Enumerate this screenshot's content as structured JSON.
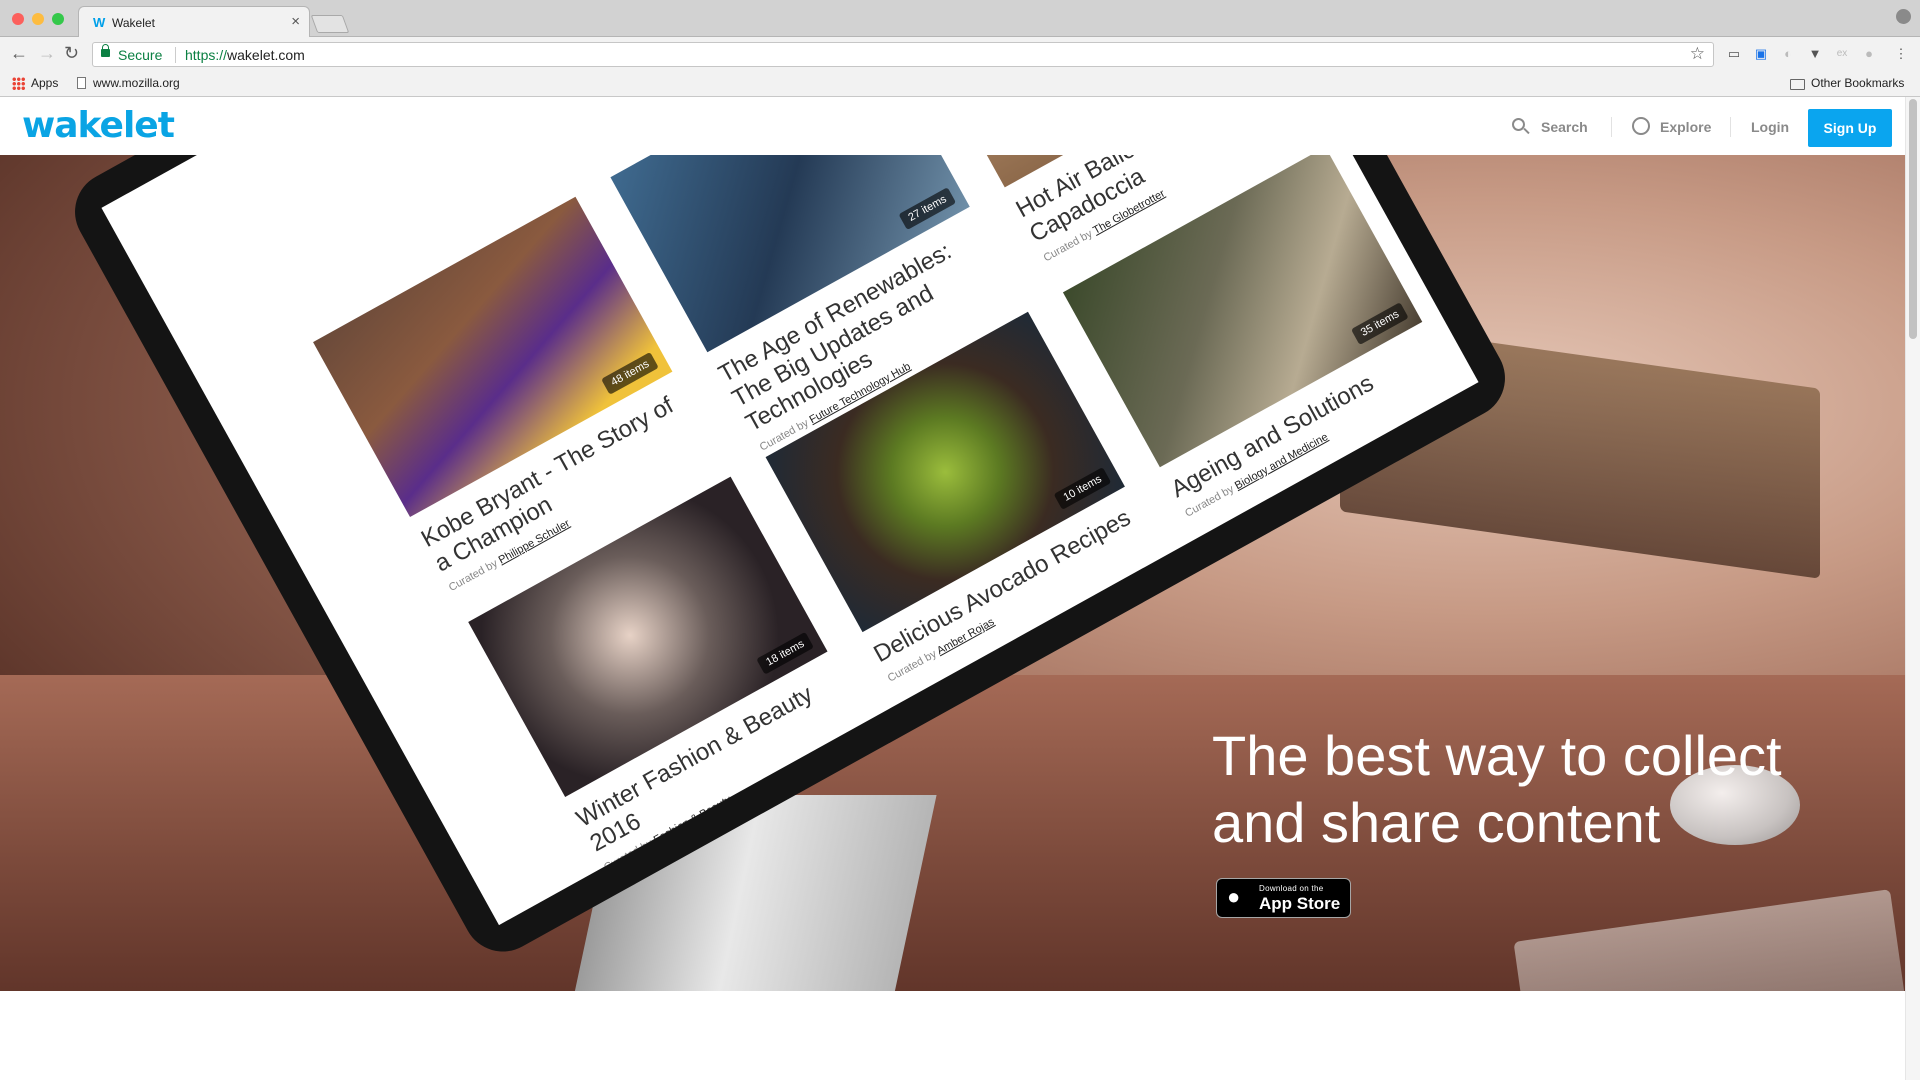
{
  "browser": {
    "tab_title": "Wakelet",
    "tab_favicon": "W",
    "secure_label": "Secure",
    "url_scheme": "https://",
    "url_host": "wakelet.com",
    "bookmarks": [
      {
        "label": "Apps"
      },
      {
        "label": "www.mozilla.org"
      }
    ],
    "other_bookmarks": "Other Bookmarks"
  },
  "header": {
    "logo": "wakelet",
    "nav": {
      "search": "Search",
      "explore": "Explore",
      "login": "Login",
      "signup": "Sign Up"
    }
  },
  "hero": {
    "tagline": "The best way to collect and share content",
    "appstore": {
      "small": "Download on the",
      "big": "App Store"
    }
  },
  "screen_cards": [
    {
      "title": "Kobe Bryant - The Story of a Champion",
      "curated_prefix": "Curated by",
      "curator": "Philippe Schuler",
      "count": "48 items"
    },
    {
      "title": "The Age of Renewables: The Big Updates and Technologies",
      "curated_prefix": "Curated by",
      "curator": "Future Technology Hub",
      "count": "27 items"
    },
    {
      "title": "Hot Air Balloon over Capadoccia",
      "curated_prefix": "Curated by",
      "curator": "The Globetrotter",
      "count": ""
    },
    {
      "title": "Winter Fashion & Beauty 2016",
      "curated_prefix": "Curated by",
      "curator": "Fashion & Beauty",
      "count": "18 items"
    },
    {
      "title": "Delicious Avocado Recipes",
      "curated_prefix": "Curated by",
      "curator": "Amber Rojas",
      "count": "10 items"
    },
    {
      "title": "Ageing and Solutions",
      "curated_prefix": "Curated by",
      "curator": "Biology and Medicine",
      "count": "35 items"
    }
  ],
  "colors": {
    "brand": "#0aa4e4",
    "signup_bg": "#0aa5ef",
    "secure_green": "#0b8043"
  },
  "icons": [
    "close-icon",
    "back-icon",
    "forward-icon",
    "reload-icon",
    "lock-icon",
    "star-icon",
    "apps-grid-icon",
    "folder-icon",
    "search-icon",
    "compass-icon",
    "apple-icon",
    "menu-dots-icon"
  ]
}
